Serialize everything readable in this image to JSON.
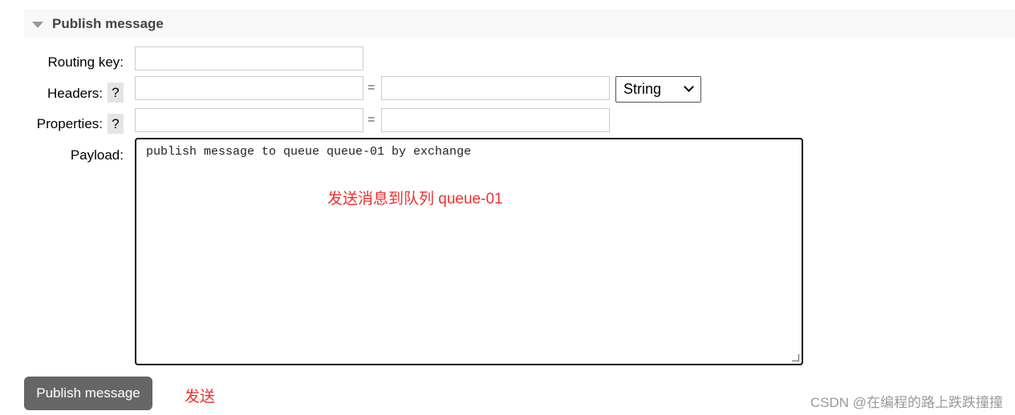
{
  "section": {
    "title": "Publish message"
  },
  "form": {
    "routing_key_label": "Routing key:",
    "headers_label": "Headers:",
    "properties_label": "Properties:",
    "payload_label": "Payload:",
    "help": "?",
    "equals": "=",
    "header_type": "String",
    "payload_value": "publish message to queue queue-01 by exchange"
  },
  "annotations": {
    "payload_note": "发送消息到队列 queue-01",
    "send_note": "发送"
  },
  "publish_button": "Publish message",
  "watermark": "CSDN @在编程的路上跌跌撞撞",
  "colors": {
    "annotation": "#f03030",
    "button": "#666666"
  }
}
